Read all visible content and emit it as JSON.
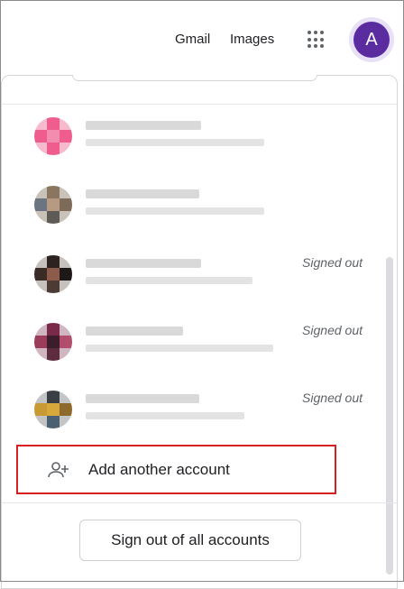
{
  "header": {
    "gmail_label": "Gmail",
    "images_label": "Images",
    "apps_icon": "apps-grid-icon",
    "avatar_letter": "A",
    "avatar_color": "#5a2ca0"
  },
  "accounts": [
    {
      "status": ""
    },
    {
      "status": ""
    },
    {
      "status": "Signed out"
    },
    {
      "status": "Signed out"
    },
    {
      "status": "Signed out"
    }
  ],
  "add_account": {
    "label": "Add another account",
    "icon": "person-add-icon"
  },
  "sign_out_all": {
    "label": "Sign out of all accounts"
  },
  "colors": {
    "highlight_border": "#d62020"
  }
}
